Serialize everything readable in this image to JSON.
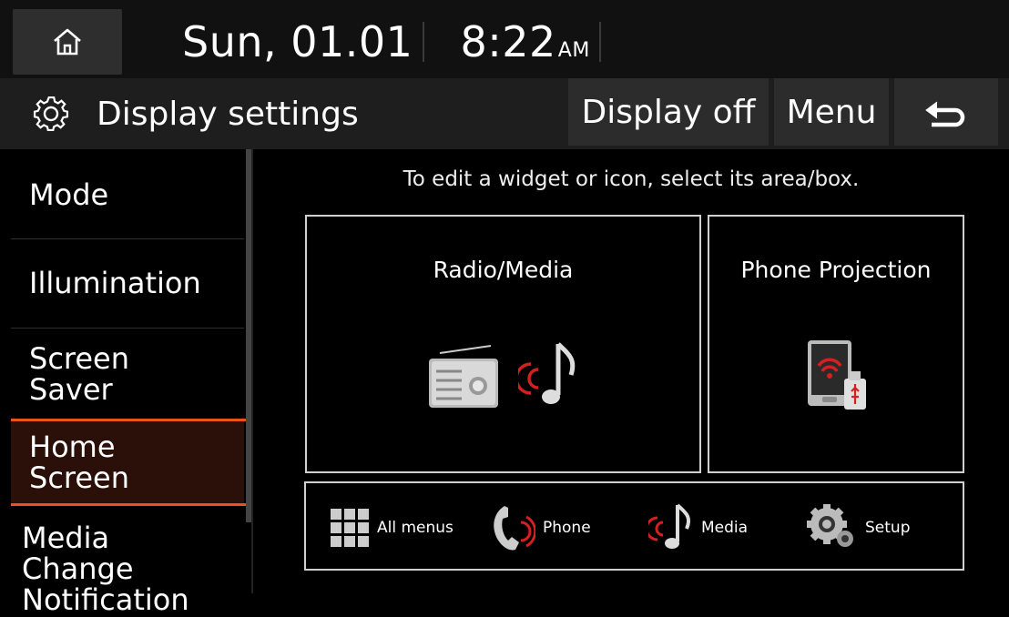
{
  "status_bar": {
    "date": "Sun, 01.01",
    "time": "8:22",
    "ampm": "AM"
  },
  "title_bar": {
    "title": "Display settings",
    "display_off_label": "Display off",
    "menu_label": "Menu"
  },
  "sidebar": {
    "items": [
      {
        "label_lines": [
          "Mode"
        ]
      },
      {
        "label_lines": [
          "Illumination"
        ]
      },
      {
        "label_lines": [
          "Screen",
          "Saver"
        ]
      },
      {
        "label_lines": [
          "Home",
          "Screen"
        ],
        "active": true
      },
      {
        "label_lines": [
          "Media",
          "Change",
          "Notification"
        ]
      }
    ]
  },
  "main": {
    "hint": "To edit a widget or icon, select its area/box.",
    "widgets": [
      {
        "title": "Radio/Media"
      },
      {
        "title": "Phone Projection"
      }
    ],
    "dock": [
      {
        "label": "All menus"
      },
      {
        "label": "Phone"
      },
      {
        "label": "Media"
      },
      {
        "label": "Setup"
      }
    ]
  },
  "colors": {
    "accent": "#e8541a",
    "active_bg": "#2a1008",
    "icon_red": "#d42020"
  }
}
